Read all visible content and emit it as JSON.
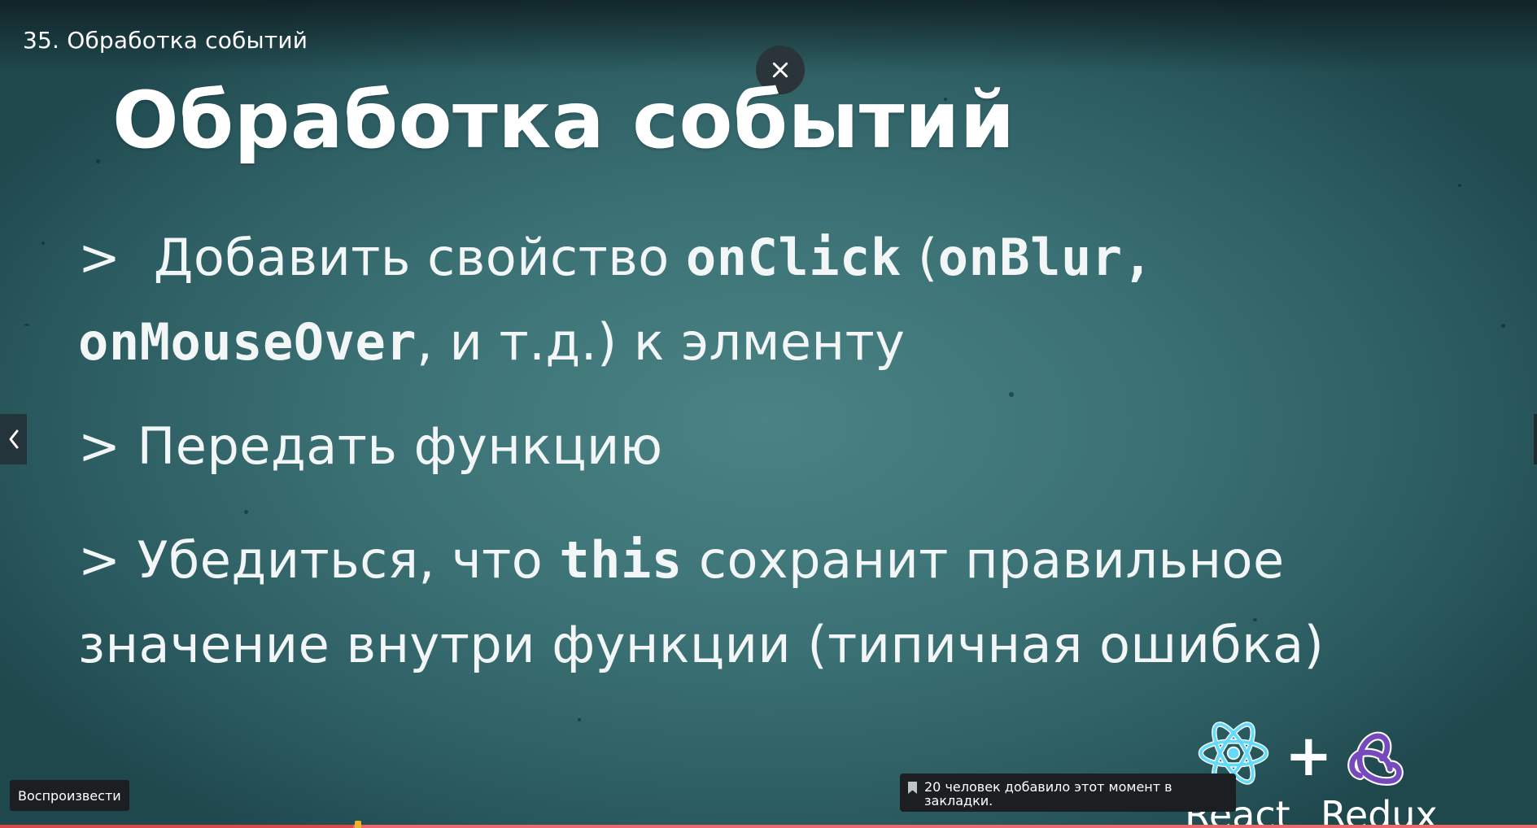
{
  "video": {
    "title": "35. Обработка событий",
    "progress_fraction": 0.23
  },
  "slide": {
    "heading": "Обработка событий",
    "bullet1": {
      "marker": ">",
      "text_a": "Добавить свойство",
      "code_a": "onClick",
      "text_b": "(",
      "code_b": "onBlur,",
      "code_c": "onMouseOver",
      "text_c": ", и т.д.) к элменту"
    },
    "bullet2": {
      "marker": ">",
      "text": "Передать функцию"
    },
    "bullet3": {
      "marker": ">",
      "text_a": "Убедиться, что",
      "code": "this",
      "text_b": "сохранит правильное",
      "line2": "значение внутри функции (типичная ошибка)"
    },
    "logos": {
      "react_label": "React",
      "plus": "+",
      "redux_label": "Redux"
    }
  },
  "controls": {
    "close_icon": "close-icon",
    "prev_icon": "chevron-left-icon",
    "play_tooltip": "Воспроизвести",
    "bookmark_tooltip": "20 человек добавило этот момент в закладки."
  },
  "colors": {
    "background": "#3b7174",
    "progress": "#e86a6a",
    "marker": "#f0b429",
    "react": "#61dafb",
    "redux": "#764abc"
  }
}
